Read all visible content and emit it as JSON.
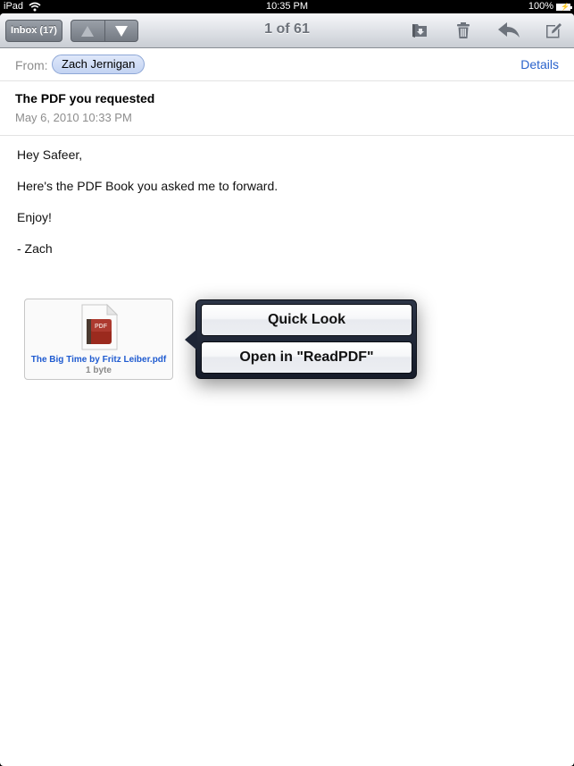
{
  "status_bar": {
    "device": "iPad",
    "wifi_icon": "wifi-icon",
    "time": "10:35 PM",
    "battery": "100%",
    "battery_icon": "battery-charging-icon"
  },
  "toolbar": {
    "inbox_label": "Inbox (17)",
    "prev_icon": "arrow-up-icon",
    "next_icon": "arrow-down-icon",
    "counter": "1 of 61",
    "actions": [
      {
        "icon": "move-to-folder-icon"
      },
      {
        "icon": "trash-icon"
      },
      {
        "icon": "reply-icon"
      },
      {
        "icon": "compose-icon"
      }
    ]
  },
  "header": {
    "from_label": "From:",
    "sender": "Zach Jernigan",
    "details_label": "Details",
    "subject": "The PDF you requested",
    "date": "May 6, 2010 10:33 PM"
  },
  "body": {
    "lines": [
      "Hey Safeer,",
      "Here's the PDF Book you asked me to forward.",
      "Enjoy!",
      "- Zach"
    ]
  },
  "attachment": {
    "icon": "pdf-file-icon",
    "icon_label": "PDF",
    "name": "The Big Time by Fritz Leiber.pdf",
    "size": "1 byte"
  },
  "popover": {
    "options": [
      {
        "label": "Quick Look"
      },
      {
        "label": "Open in \"ReadPDF\""
      }
    ]
  },
  "colors": {
    "link": "#2a63cc",
    "attachment_name": "#1f5bd0",
    "popover_bg": "#1e2536"
  }
}
